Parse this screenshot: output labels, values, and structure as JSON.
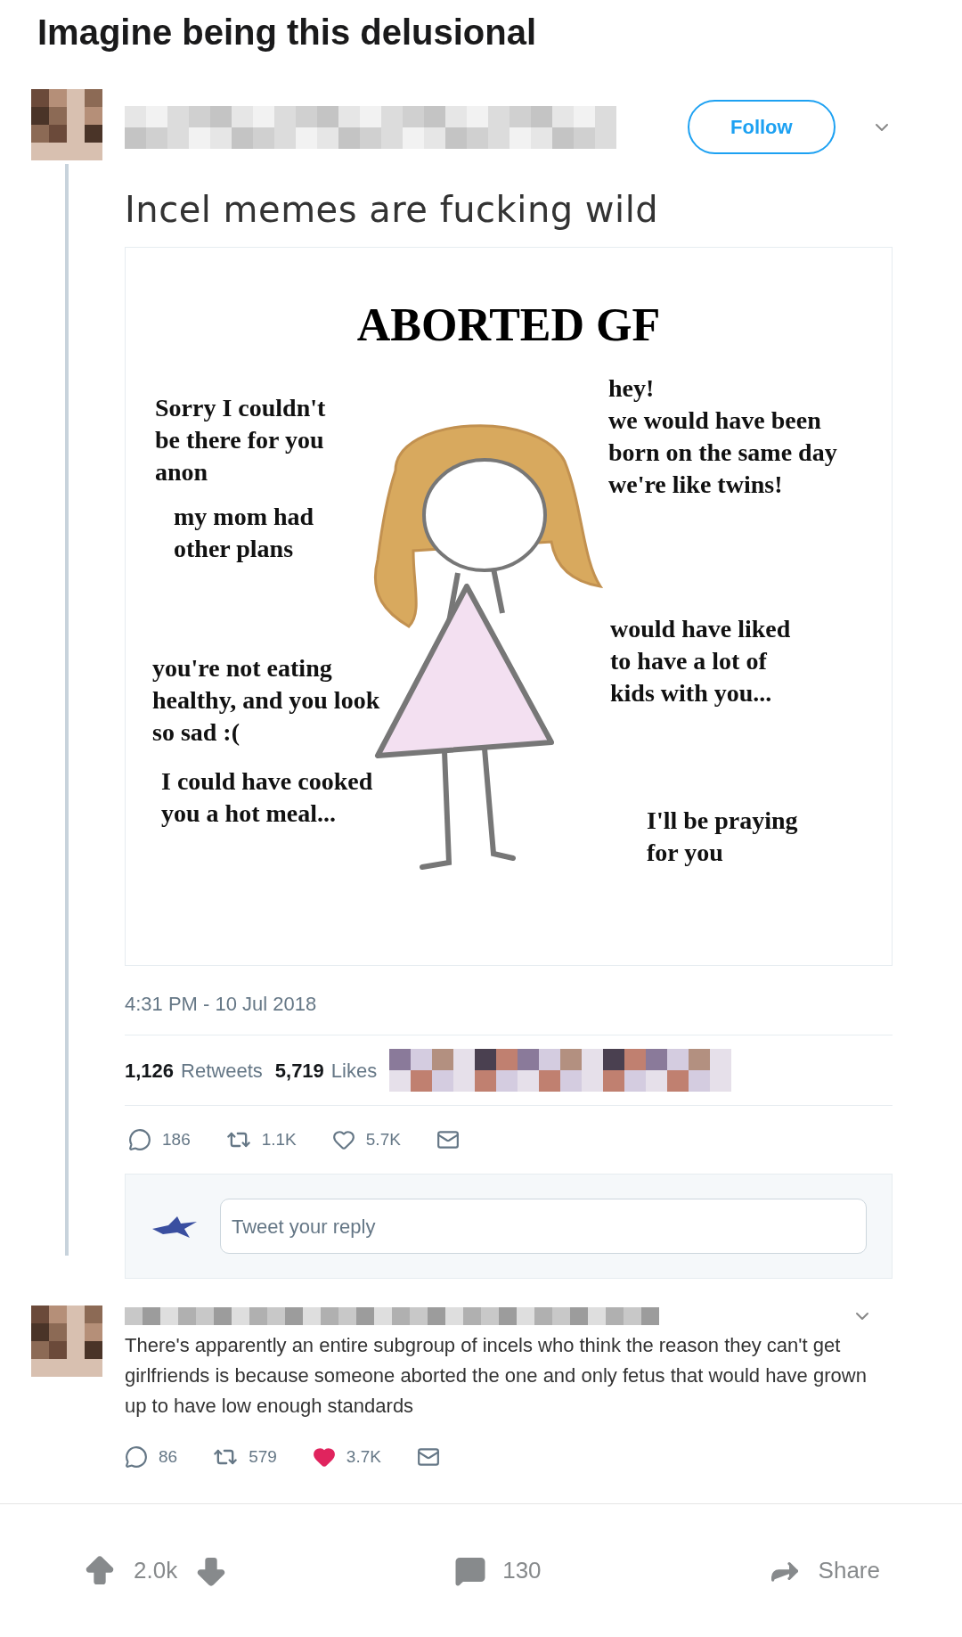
{
  "post_title": "Imagine being this delusional",
  "tweet": {
    "follow_label": "Follow",
    "text": "Incel memes are fucking wild",
    "meme": {
      "title": "ABORTED GF",
      "captions": [
        "Sorry I couldn't\nbe there for you\nanon",
        "my mom had\nother plans",
        "you're not eating\nhealthy, and you look\nso sad :(",
        "I could have cooked\nyou a hot meal...",
        "hey!\nwe would have been\nborn on the same day\nwe're like twins!",
        "would have liked\nto have a lot of\nkids with you...",
        "I'll be praying\nfor you"
      ]
    },
    "timestamp": "4:31 PM - 10 Jul 2018",
    "retweets_count": "1,126",
    "retweets_label": "Retweets",
    "likes_count": "5,719",
    "likes_label": "Likes",
    "actions": [
      {
        "kind": "reply",
        "count": "186"
      },
      {
        "kind": "retweet",
        "count": "1.1K"
      },
      {
        "kind": "like",
        "count": "5.7K",
        "liked": false
      },
      {
        "kind": "message"
      }
    ],
    "reply_placeholder": "Tweet your reply"
  },
  "reply": {
    "text": "There's apparently an entire subgroup of incels who think the reason they can't get girlfriends is because someone aborted the one and only fetus that would have grown up to have low enough standards",
    "actions": [
      {
        "kind": "reply",
        "count": "86"
      },
      {
        "kind": "retweet",
        "count": "579"
      },
      {
        "kind": "like",
        "count": "3.7K",
        "liked": true
      },
      {
        "kind": "message"
      }
    ]
  },
  "footer": {
    "score": "2.0k",
    "comments": "130",
    "share": "Share"
  }
}
